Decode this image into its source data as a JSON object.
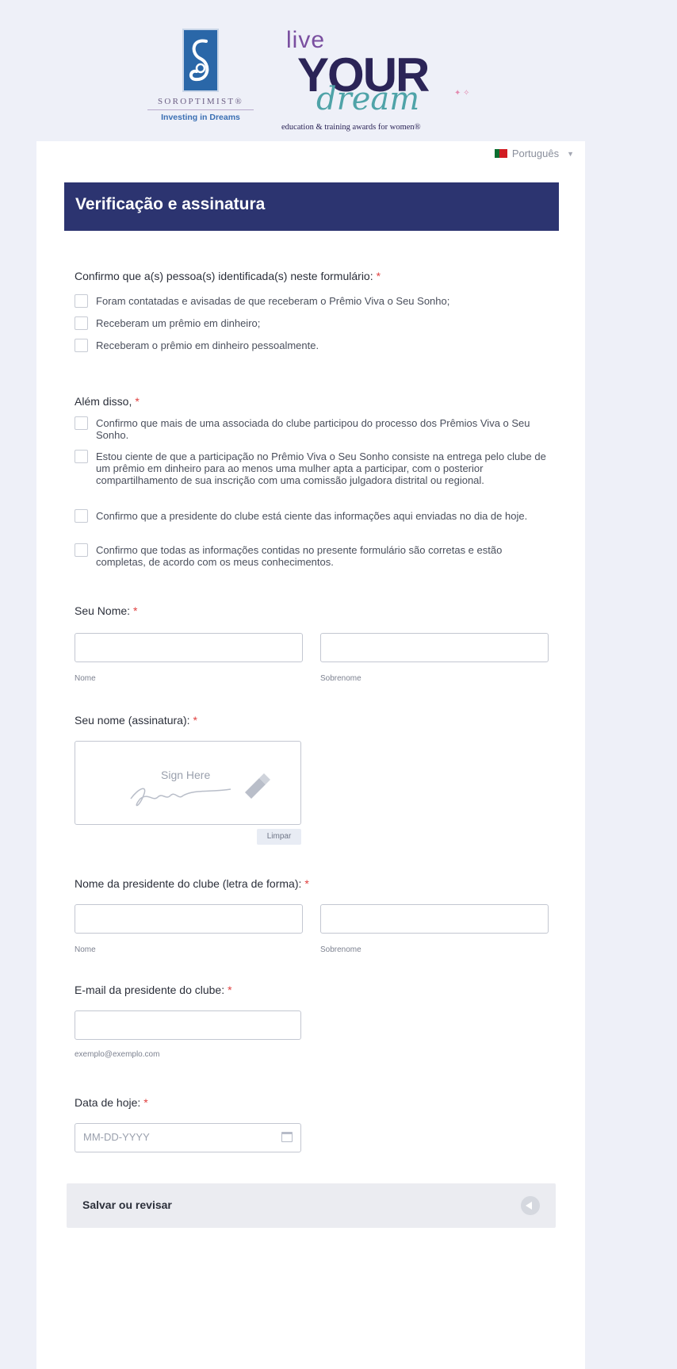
{
  "logos": {
    "soroptimist_word": "SOROPTIMIST®",
    "soroptimist_tagline": "Investing in Dreams",
    "lyd_live": "live",
    "lyd_your": "YOUR",
    "lyd_dream": "dream",
    "lyd_tagline": "education & training awards for women®"
  },
  "language": {
    "selected": "Português",
    "flag_icon": "portugal-flag-icon"
  },
  "header": {
    "title": "Verificação e assinatura",
    "bg_color": "#2c3470"
  },
  "confirm_section": {
    "label": "Confirmo que a(s) pessoa(s) identificada(s) neste formulário:",
    "required_mark": "*",
    "options": [
      "Foram contatadas e avisadas de que receberam o Prêmio Viva o Seu Sonho;",
      "Receberam um prêmio em dinheiro;",
      "Receberam o prêmio em dinheiro pessoalmente."
    ]
  },
  "also_section": {
    "label": "Além disso,",
    "required_mark": "*",
    "options": [
      "Confirmo que mais de uma associada do clube participou do processo dos Prêmios Viva o Seu Sonho.",
      "Estou ciente de que a participação no Prêmio Viva o Seu Sonho consiste na entrega pelo clube de um prêmio em dinheiro para ao menos uma mulher apta a participar, com o posterior compartilhamento de sua inscrição com uma comissão julgadora distrital ou regional.",
      "Confirmo que a presidente do clube está ciente das informações aqui enviadas no dia de hoje.",
      "Confirmo que todas as informações contidas no presente formulário são corretas e estão completas, de acordo com os meus conhecimentos."
    ]
  },
  "your_name": {
    "label": "Seu Nome:",
    "required_mark": "*",
    "first_sub": "Nome",
    "last_sub": "Sobrenome",
    "first_value": "",
    "last_value": ""
  },
  "signature": {
    "label": "Seu nome (assinatura):",
    "required_mark": "*",
    "placeholder": "Sign Here",
    "clear_label": "Limpar"
  },
  "president_name": {
    "label": "Nome da presidente do clube (letra de forma):",
    "required_mark": "*",
    "first_sub": "Nome",
    "last_sub": "Sobrenome"
  },
  "president_email": {
    "label": "E-mail da presidente do clube:",
    "required_mark": "*",
    "sub": "exemplo@exemplo.com",
    "value": ""
  },
  "today_date": {
    "label": "Data de hoje:",
    "required_mark": "*",
    "placeholder": "MM-DD-YYYY"
  },
  "footer": {
    "save_label": "Salvar ou revisar"
  }
}
